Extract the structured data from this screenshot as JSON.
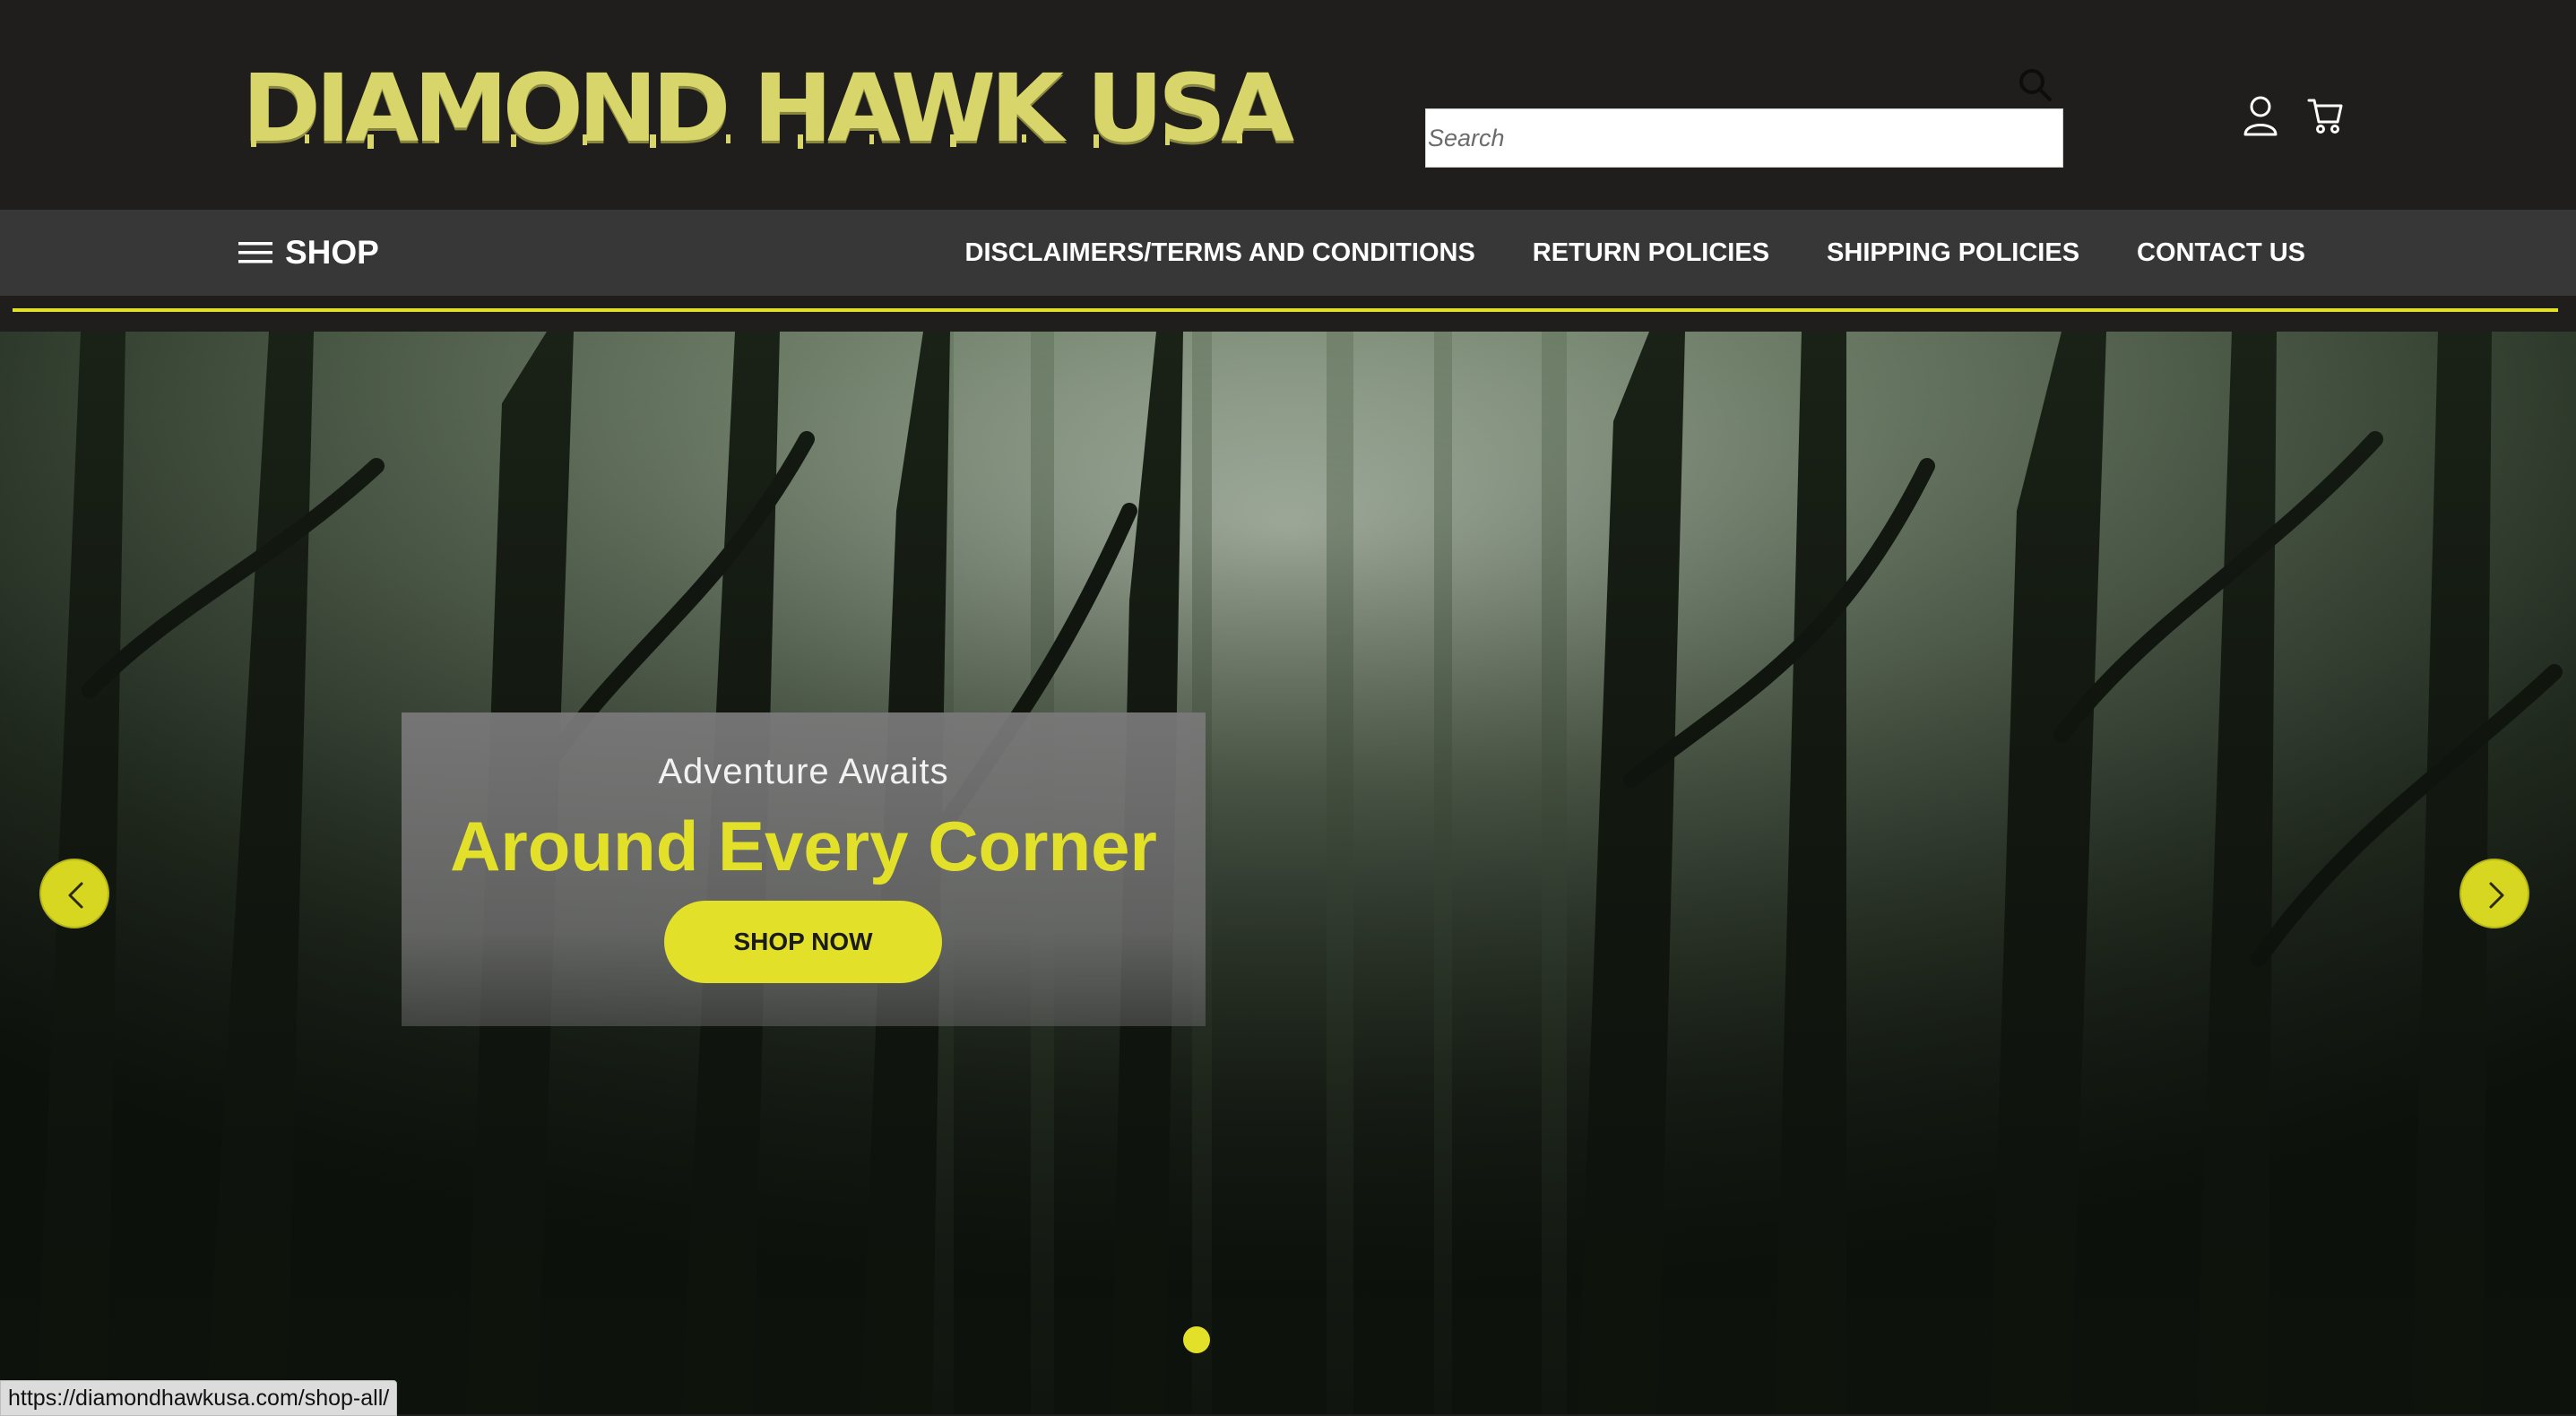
{
  "header": {
    "logo_text": "DIAMOND HAWK USA",
    "search": {
      "placeholder": "Search",
      "value": ""
    },
    "icons": [
      "search-icon",
      "account-icon",
      "cart-icon"
    ]
  },
  "nav": {
    "shop_label": "SHOP",
    "links": [
      {
        "label": "DISCLAIMERS/TERMS AND CONDITIONS"
      },
      {
        "label": "RETURN POLICIES"
      },
      {
        "label": "SHIPPING POLICIES"
      },
      {
        "label": "CONTACT US"
      }
    ]
  },
  "hero": {
    "subtitle": "Adventure Awaits",
    "title": "Around Every Corner",
    "cta_label": "SHOP NOW",
    "slide_count": 1,
    "active_slide": 1
  },
  "status_bar": {
    "url": "https://diamondhawkusa.com/shop-all/"
  },
  "colors": {
    "accent": "#e3e02a",
    "logo": "#d8d56a",
    "header_bg": "#1f1e1c",
    "nav_bg": "#373737",
    "promo_box": "#777777"
  }
}
